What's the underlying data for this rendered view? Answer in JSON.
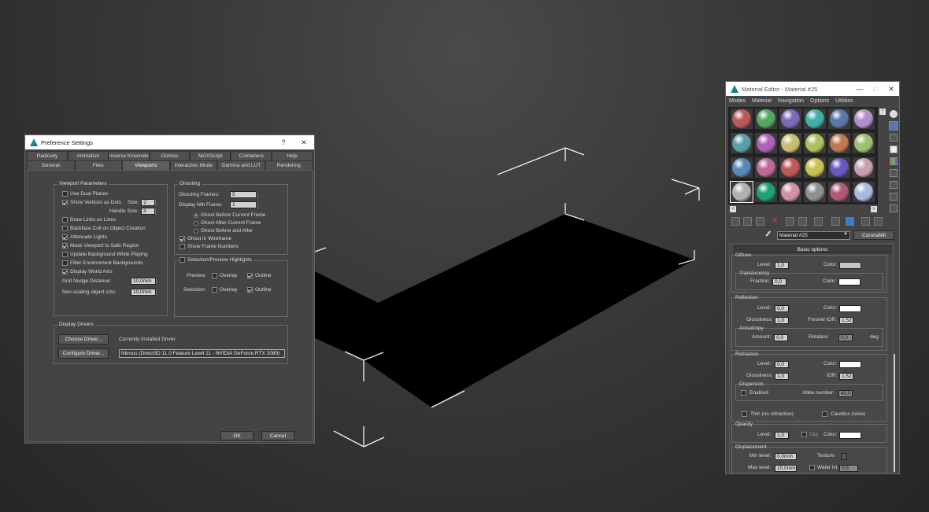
{
  "pref": {
    "title": "Preference Settings",
    "help": "?",
    "close": "✕",
    "tabs_row1": [
      "Radiosity",
      "Animation",
      "Inverse Kinematics",
      "Gizmos",
      "MAXScript",
      "Containers",
      "Help"
    ],
    "tabs_row2": [
      "General",
      "Files",
      "Viewports",
      "Interaction Mode",
      "Gamma and LUT",
      "Rendering"
    ],
    "selected_tab": "Viewports",
    "vp_title": "Viewport Parameters",
    "vp_items": [
      {
        "label": "Use Dual Planes",
        "checked": false
      },
      {
        "label": "Show Vertices as Dots",
        "checked": true
      },
      {
        "label": "Draw Links as Lines",
        "checked": false
      },
      {
        "label": "Backface Cull on Object Creation",
        "checked": false
      },
      {
        "label": "Attenuate Lights",
        "checked": true
      },
      {
        "label": "Mask Viewport to Safe Region",
        "checked": true
      },
      {
        "label": "Update Background While Playing",
        "checked": false
      },
      {
        "label": "Filter Environment Backgrounds",
        "checked": false
      },
      {
        "label": "Display World Axis",
        "checked": true
      }
    ],
    "size_label": "Size:",
    "size_value": "2",
    "handle_label": "Handle Size:",
    "handle_value": "3",
    "nudge_label": "Grid Nudge Distance:",
    "nudge_value": "10,0mm",
    "nonscale_label": "Non-scaling object size:",
    "nonscale_value": "10,0mm",
    "ghost_title": "Ghosting",
    "ghost_frames_label": "Ghosting Frames:",
    "ghost_frames_value": "5",
    "nth_label": "Display Nth Frame:",
    "nth_value": "1",
    "ghost_radios": [
      {
        "label": "Ghost Before Current Frame",
        "selected": true
      },
      {
        "label": "Ghost After Current Frame",
        "selected": false
      },
      {
        "label": "Ghost Before and After",
        "selected": false
      }
    ],
    "ghost_wire": "Ghost in Wireframe",
    "ghost_wire_checked": true,
    "frame_numbers": "Show Frame Numbers",
    "frame_numbers_checked": false,
    "sel_title": "Selection/Preview Highlights",
    "preview_label": "Preview:",
    "selection_label": "Selection:",
    "overlay": "Overlay",
    "outline": "Outline",
    "dd_title": "Display Drivers",
    "choose_driver": "Choose Driver...",
    "configure_driver": "Configure Driver...",
    "current_driver_label": "Currently Installed Driver:",
    "driver": "Nitrous (Direct3D 11.0 Feature Level 11 - NVIDIA GeForce RTX 2080)",
    "ok": "OK",
    "cancel": "Cancel"
  },
  "med": {
    "title": "Material Editor - Material #25",
    "min": "—",
    "max": "□",
    "close": "✕",
    "menu": [
      "Modes",
      "Material",
      "Navigation",
      "Options",
      "Utilities"
    ],
    "sphere_colors": [
      [
        "#b85a5a",
        "#55a860",
        "#7a6ab8",
        "#3fb0a8",
        "#5a78a8",
        "#b090c8"
      ],
      [
        "#5aa0a8",
        "#b060b8",
        "#c8c070",
        "#b0c060",
        "#c07850",
        "#a0c070"
      ],
      [
        "#5a88b8",
        "#c06898",
        "#c05858",
        "#c8c050",
        "#6a58c0",
        "#c8a0b0"
      ],
      [
        "#b0b0b0",
        "#20a070",
        "#d090a8",
        "#909090",
        "#b05878",
        "#a8b8e0"
      ]
    ],
    "material_name": "Material #25",
    "material_type": "CoronaMtl",
    "rollout": "Basic options",
    "diffuse": "Diffuse",
    "level": "Level:",
    "color": "Color:",
    "diffuse_level": "1,0",
    "translucency": "Translucency",
    "fraction": "Fraction:",
    "fraction_value": "0,0",
    "reflection": "Reflection",
    "refl_level": "0,0",
    "glossiness": "Glossiness:",
    "refl_gloss": "1,0",
    "fresnel": "Fresnel IOR:",
    "fresnel_value": "1,52",
    "anisotropy": "Anisotropy",
    "amount": "Amount:",
    "amount_value": "0,0",
    "rotation": "Rotation:",
    "rotation_value": "0,0",
    "deg": "deg",
    "refraction": "Refraction",
    "refr_level": "0,0",
    "refr_gloss": "1,0",
    "ior": "IOR:",
    "ior_value": "1,52",
    "dispersion": "Dispersion",
    "enabled": "Enabled",
    "abbe": "Abbe number:",
    "abbe_value": "40,0",
    "thin": "Thin (no refraction)",
    "caustics": "Caustics (slow)",
    "opacity": "Opacity",
    "op_level": "1,0",
    "clip": "Clip",
    "displacement": "Displacement",
    "min_level": "Min level:",
    "min_value": "0,0mm",
    "texture": "Texture:",
    "max_level": "Max level:",
    "max_value": "10,0mm",
    "water": "Water lvl.",
    "water_value": "0,5",
    "colors": {
      "diffuse": "#c8c8c8",
      "white": "#ffffff"
    }
  }
}
